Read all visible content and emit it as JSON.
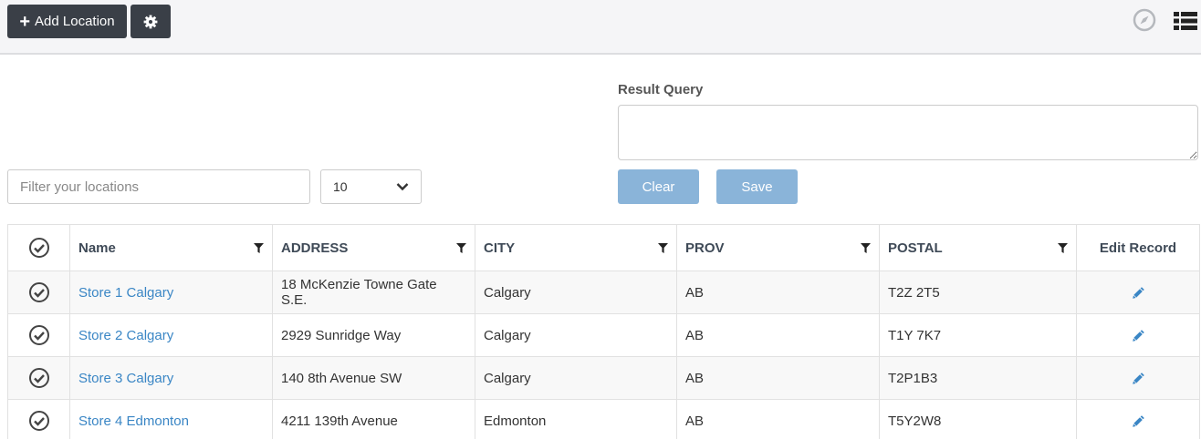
{
  "toolbar": {
    "add_location_label": "Add Location",
    "settings_icon": "gear-icon",
    "compass_icon": "compass-icon",
    "list_view_icon": "list-view-icon"
  },
  "result_query": {
    "label": "Result Query",
    "value": "",
    "clear_label": "Clear",
    "save_label": "Save"
  },
  "filter": {
    "placeholder": "Filter your locations",
    "value": ""
  },
  "page_size": {
    "selected": "10"
  },
  "colors": {
    "dark_button": "#3a3f47",
    "light_button": "#8ab4d9",
    "link": "#3a86c5"
  },
  "table": {
    "headers": {
      "name": "Name",
      "address": "ADDRESS",
      "city": "CITY",
      "prov": "PROV",
      "postal": "POSTAL",
      "edit": "Edit Record"
    },
    "rows": [
      {
        "name": "Store 1 Calgary",
        "address": "18 McKenzie Towne Gate S.E.",
        "city": "Calgary",
        "prov": "AB",
        "postal": "T2Z 2T5"
      },
      {
        "name": "Store 2 Calgary",
        "address": "2929 Sunridge Way",
        "city": "Calgary",
        "prov": "AB",
        "postal": "T1Y 7K7"
      },
      {
        "name": "Store 3 Calgary",
        "address": "140 8th Avenue SW",
        "city": "Calgary",
        "prov": "AB",
        "postal": "T2P1B3"
      },
      {
        "name": "Store 4 Edmonton",
        "address": "4211 139th Avenue",
        "city": "Edmonton",
        "prov": "AB",
        "postal": "T5Y2W8"
      }
    ]
  }
}
